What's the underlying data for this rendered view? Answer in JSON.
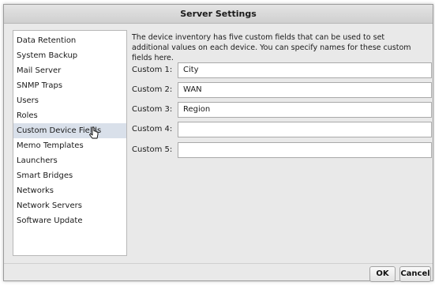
{
  "dialog": {
    "title": "Server Settings"
  },
  "sidebar": {
    "items": [
      {
        "label": "Data Retention"
      },
      {
        "label": "System Backup"
      },
      {
        "label": "Mail Server"
      },
      {
        "label": "SNMP Traps"
      },
      {
        "label": "Users"
      },
      {
        "label": "Roles"
      },
      {
        "label": "Custom Device Fields"
      },
      {
        "label": "Memo Templates"
      },
      {
        "label": "Launchers"
      },
      {
        "label": "Smart Bridges"
      },
      {
        "label": "Networks"
      },
      {
        "label": "Network Servers"
      },
      {
        "label": "Software Update"
      }
    ],
    "selected": "Custom Device Fields"
  },
  "content": {
    "description": "The device inventory has five custom fields that can be used to set additional values on each device.  You can specify names for these custom fields here.",
    "fields": [
      {
        "label": "Custom 1:",
        "value": "City"
      },
      {
        "label": "Custom 2:",
        "value": "WAN"
      },
      {
        "label": "Custom 3:",
        "value": "Region"
      },
      {
        "label": "Custom 4:",
        "value": ""
      },
      {
        "label": "Custom 5:",
        "value": ""
      }
    ]
  },
  "footer": {
    "ok_label": "OK",
    "cancel_label": "Cancel"
  },
  "colors": {
    "selected_bg": "#d9e0ea",
    "dialog_bg": "#e9e9e9"
  }
}
